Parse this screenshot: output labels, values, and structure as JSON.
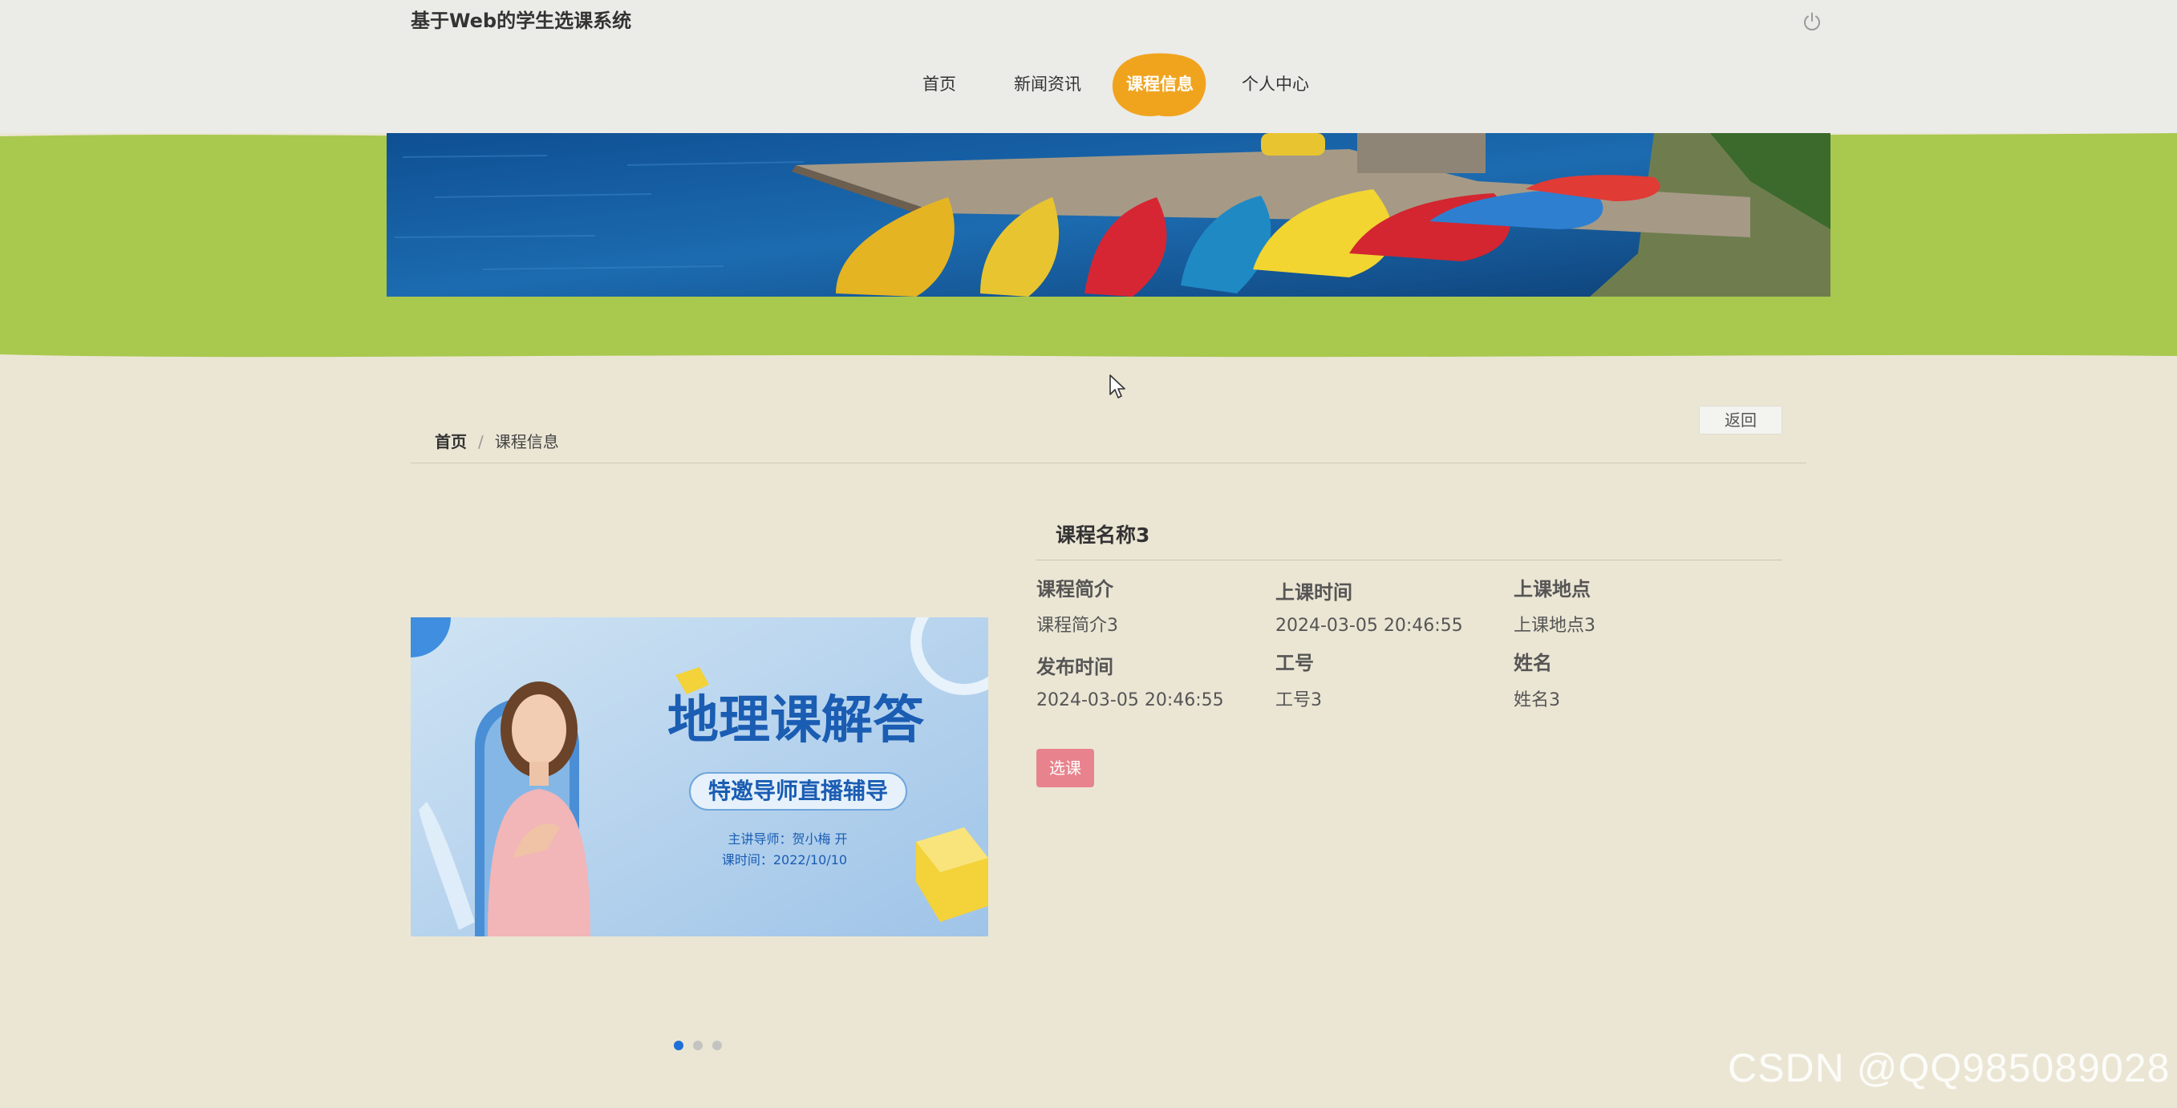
{
  "header": {
    "site_title": "基于Web的学生选课系统",
    "power_icon": "power-icon"
  },
  "nav": {
    "items": [
      {
        "label": "首页",
        "active": false
      },
      {
        "label": "新闻资讯",
        "active": false
      },
      {
        "label": "课程信息",
        "active": true
      },
      {
        "label": "个人中心",
        "active": false
      }
    ],
    "active_color": "#f0a41e"
  },
  "band_color": "#a9c84e",
  "breadcrumb": {
    "home": "首页",
    "separator": "/",
    "current": "课程信息"
  },
  "back_button": "返回",
  "carousel": {
    "poster": {
      "headline": "地理课解答",
      "sub": "特邀导师直播辅导",
      "line1": "主讲导师：贺小梅 开",
      "line2": "课时间：2022/10/10"
    },
    "slides_count": 3,
    "active_index": 0
  },
  "course": {
    "title": "课程名称3",
    "fields": [
      {
        "label": "课程简介",
        "value": "课程简介3"
      },
      {
        "label": "上课时间",
        "value": "2024-03-05 20:46:55"
      },
      {
        "label": "上课地点",
        "value": "上课地点3"
      },
      {
        "label": "发布时间",
        "value": "2024-03-05 20:46:55"
      },
      {
        "label": "工号",
        "value": "工号3"
      },
      {
        "label": "姓名",
        "value": "姓名3"
      }
    ],
    "select_button": "选课",
    "select_button_color": "#e8838d"
  },
  "watermark": "CSDN @QQ985089028"
}
